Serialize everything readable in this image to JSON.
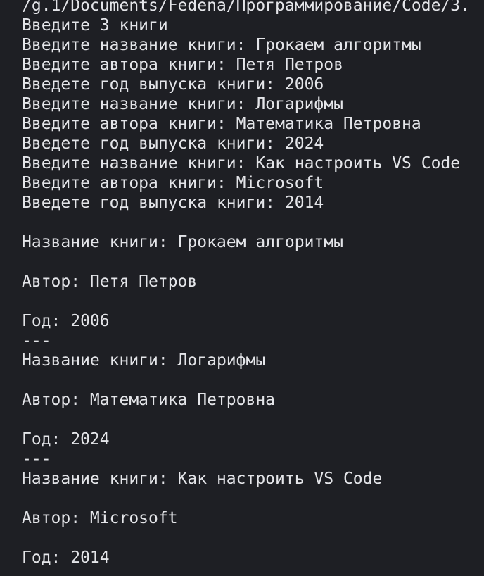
{
  "terminal": {
    "background": "#1e1f24",
    "foreground": "#e4e5e9",
    "lines": [
      "/g.1/Documents/Fedena/Программирование/Code/3.",
      "Введите 3 книги",
      "Введите название книги: Грокаем алгоритмы",
      "Введите автора книги: Петя Петров",
      "Введете год выпуска книги: 2006",
      "Введите название книги: Логарифмы",
      "Введите автора книги: Математика Петровна",
      "Введете год выпуска книги: 2024",
      "Введите название книги: Как настроить VS Code",
      "Введите автора книги: Microsoft",
      "Введете год выпуска книги: 2014",
      "",
      "Название книги: Грокаем алгоритмы",
      "",
      "Автор: Петя Петров",
      "",
      "Год: 2006",
      "---",
      "Название книги: Логарифмы",
      "",
      "Автор: Математика Петровна",
      "",
      "Год: 2024",
      "---",
      "Название книги: Как настроить VS Code",
      "",
      "Автор: Microsoft",
      "",
      "Год: 2014",
      "---"
    ]
  }
}
